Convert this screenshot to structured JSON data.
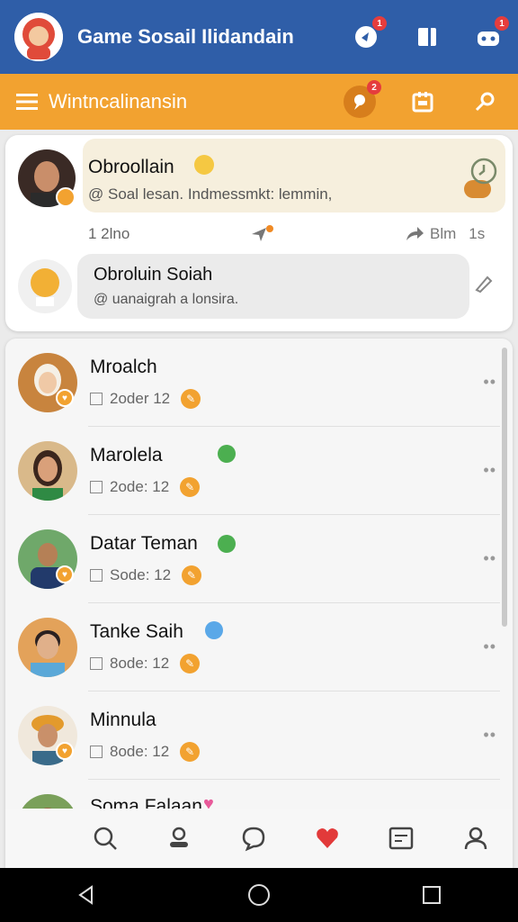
{
  "appbar": {
    "title": "Game Sosail Ilidandain",
    "badge1": "1",
    "badge2": "1"
  },
  "subbar": {
    "title": "Wintncalinansin",
    "badge": "2"
  },
  "featured": {
    "name": "Obroollain",
    "message": "@ Soal lesan. Indmessmkt: lemmin,",
    "likes": "1 2lno",
    "share": "Blm",
    "time": "1s"
  },
  "chat": {
    "name": "Obroluin Soiah",
    "message": "@ uanaigrah a lonsira."
  },
  "contacts": [
    {
      "name": "Mroalch",
      "meta": "2oder 12"
    },
    {
      "name": "Marolela",
      "meta": "2ode: 12"
    },
    {
      "name": "Datar Teman",
      "meta": "Sode: 12"
    },
    {
      "name": "Tanke Saih",
      "meta": "8ode: 12"
    },
    {
      "name": "Minnula",
      "meta": "8ode: 12"
    },
    {
      "name": "Soma Falaan",
      "meta": ""
    }
  ],
  "colors": {
    "appbar": "#2f5ea8",
    "subbar": "#f2a230",
    "accent_red": "#e53d3d",
    "online_green": "#4caf50"
  },
  "icons": [
    "logo-avatar-icon",
    "notification-icon",
    "bookmark-icon",
    "gamepad-icon",
    "menu-icon",
    "alert-icon",
    "calendar-icon",
    "search-icon",
    "home-icon",
    "chat-icon",
    "heart-icon",
    "message-box-icon",
    "profile-icon",
    "back-icon",
    "home-circle-icon",
    "recents-icon"
  ]
}
